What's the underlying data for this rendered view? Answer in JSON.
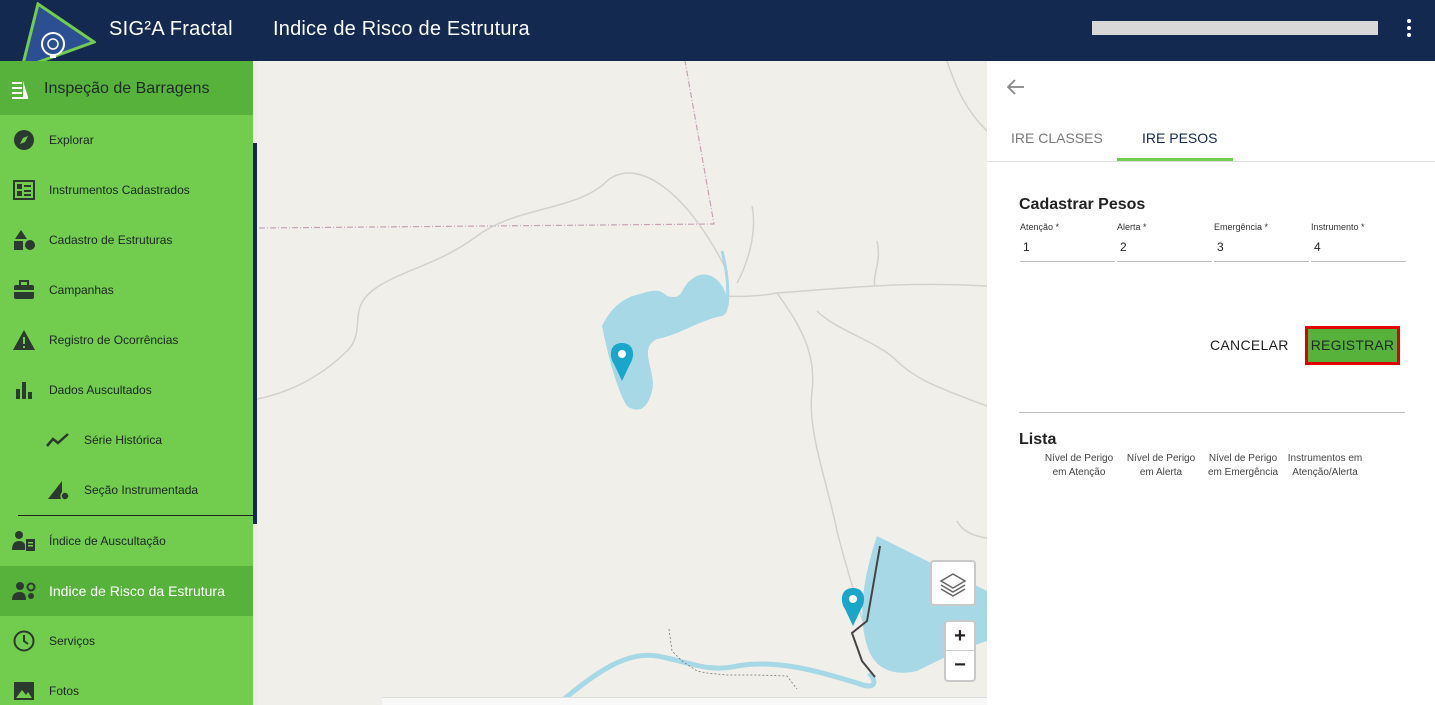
{
  "header": {
    "app_name": "SIG²A Fractal",
    "page_title": "Indice de Risco de Estrutura",
    "logo_icon": "gear-lightbulb-icon",
    "menu_icon": "kebab-menu-icon"
  },
  "sidebar": {
    "title": "Inspeção de Barragens",
    "items": [
      {
        "label": "Explorar",
        "icon": "compass-icon"
      },
      {
        "label": "Instrumentos Cadastrados",
        "icon": "dashboard-icon"
      },
      {
        "label": "Cadastro de Estruturas",
        "icon": "shapes-icon"
      },
      {
        "label": "Campanhas",
        "icon": "briefcase-icon"
      },
      {
        "label": "Registro de Ocorrências",
        "icon": "warning-icon"
      },
      {
        "label": "Dados Auscultados",
        "icon": "bar-chart-icon"
      },
      {
        "label": "Série Histórica",
        "icon": "trend-line-icon"
      },
      {
        "label": "Seção Instrumentada",
        "icon": "ruler-gear-icon"
      },
      {
        "label": "Índice de Auscultação",
        "icon": "person-clipboard-icon"
      },
      {
        "label": "Indice de Risco da Estrutura",
        "icon": "person-gear-icon"
      },
      {
        "label": "Serviços",
        "icon": "clock-icon"
      },
      {
        "label": "Fotos",
        "icon": "image-icon"
      }
    ]
  },
  "map": {
    "zoom_in": "+",
    "zoom_out": "−",
    "layers_icon": "layers-icon",
    "marker_icon": "map-pin-icon"
  },
  "panel": {
    "tabs": [
      {
        "label": "IRE CLASSES"
      },
      {
        "label": "IRE PESOS"
      }
    ],
    "form_title": "Cadastrar Pesos",
    "fields": [
      {
        "label": "Atenção *",
        "value": "1"
      },
      {
        "label": "Alerta *",
        "value": "2"
      },
      {
        "label": "Emergência *",
        "value": "3"
      },
      {
        "label": "Instrumento *",
        "value": "4"
      }
    ],
    "cancel_label": "CANCELAR",
    "register_label": "REGISTRAR",
    "list_title": "Lista",
    "columns": [
      {
        "line1": "Nível de Perigo",
        "line2": "em Atenção"
      },
      {
        "line1": "Nível de Perigo",
        "line2": "em Alerta"
      },
      {
        "line1": "Nível de Perigo",
        "line2": "em Emergência"
      },
      {
        "line1": "Instrumentos em",
        "line2": "Atenção/Alerta"
      }
    ]
  },
  "colors": {
    "header_bg": "#13294f",
    "sidebar_bg": "#72cd4e",
    "sidebar_active": "#57b23b",
    "highlight_border": "#e00000",
    "water": "#a6d8e6",
    "marker": "#1aa6c8"
  }
}
